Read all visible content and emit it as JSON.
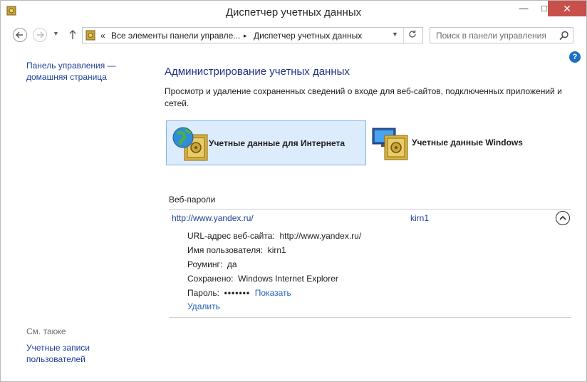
{
  "window": {
    "title": "Диспетчер учетных данных",
    "min_glyph": "—",
    "max_glyph": "□",
    "close_glyph": "✕"
  },
  "nav": {
    "breadcrumb_prefix": "«",
    "breadcrumb": [
      "Все элементы панели управле...",
      "Диспетчер учетных данных"
    ],
    "breadcrumb_sep": "▸",
    "search_placeholder": "Поиск в панели управления"
  },
  "help_glyph": "?",
  "sidebar": {
    "home_link": "Панель управления — домашняя страница",
    "see_also_label": "См. также",
    "see_also_link": "Учетные записи пользователей"
  },
  "main": {
    "title": "Администрирование учетных данных",
    "description": "Просмотр и удаление сохраненных сведений о входе для веб-сайтов, подключенных приложений и сетей.",
    "tiles": [
      {
        "label": "Учетные данные для Интернета",
        "icon": "globe-vault-icon",
        "selected": true
      },
      {
        "label": "Учетные данные Windows",
        "icon": "monitor-vault-icon",
        "selected": false
      }
    ]
  },
  "web_passwords": {
    "section_title": "Веб-пароли",
    "items": [
      {
        "url": "http://www.yandex.ru/",
        "user": "kirn1",
        "expanded": true,
        "details": {
          "url_label": "URL-адрес веб-сайта:",
          "url_value": "http://www.yandex.ru/",
          "user_label": "Имя пользователя:",
          "user_value": "kirn1",
          "roaming_label": "Роуминг:",
          "roaming_value": "да",
          "saved_label": "Сохранено:",
          "saved_value": "Windows Internet Explorer",
          "password_label": "Пароль:",
          "password_value": "•••••••",
          "show_link": "Показать",
          "delete_link": "Удалить"
        }
      }
    ]
  },
  "colors": {
    "link": "#1e3f99",
    "title_blue": "#1e3287",
    "selected_tile_bg": "#ddecfc",
    "selected_tile_border": "#7eb4ea",
    "close_button": "#c7504b",
    "help_icon": "#1c6fc2"
  }
}
